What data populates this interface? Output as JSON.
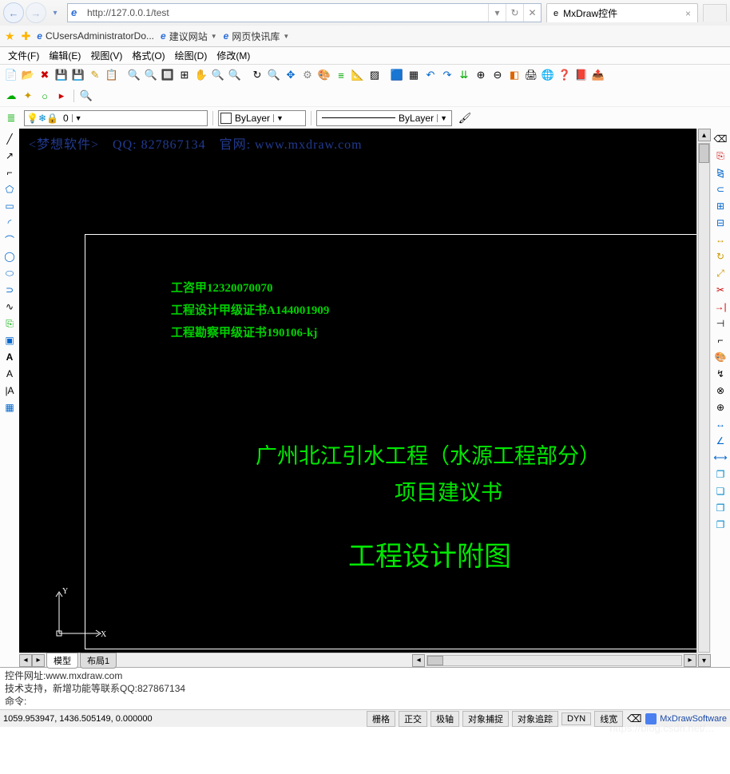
{
  "browser": {
    "url": "http://127.0.0.1/test",
    "tab_title": "MxDraw控件",
    "fav1": "CUsersAdministratorDo...",
    "fav2": "建议网站",
    "fav3": "网页快讯库"
  },
  "menu": {
    "file": "文件(F)",
    "edit": "编辑(E)",
    "view": "视图(V)",
    "format": "格式(O)",
    "draw": "绘图(D)",
    "modify": "修改(M)"
  },
  "layer": {
    "current": "0",
    "color_label": "ByLayer",
    "linetype_label": "ByLayer"
  },
  "canvas": {
    "header": "<梦想软件>　QQ: 827867134　官网: www.mxdraw.com",
    "line1": "工咨甲12320070070",
    "line2": "工程设计甲级证书A144001909",
    "line3": "工程勘察甲级证书190106-kj",
    "title1": "广州北江引水工程（水源工程部分）",
    "title2": "项目建议书",
    "title3": "工程设计附图",
    "ucs_x": "X",
    "ucs_y": "Y"
  },
  "tabs": {
    "model": "模型",
    "layout1": "布局1"
  },
  "cmd": {
    "l1": "控件网址:www.mxdraw.com",
    "l2": "技术支持，新增功能等联系QQ:827867134",
    "prompt": "命令:"
  },
  "status": {
    "coords": "1059.953947,  1436.505149,  0.000000",
    "b1": "栅格",
    "b2": "正交",
    "b3": "极轴",
    "b4": "对象捕捉",
    "b5": "对象追踪",
    "b6": "DYN",
    "b7": "线宽",
    "brand": "MxDrawSoftware"
  },
  "watermark": "https://blog.csdn.net/..."
}
